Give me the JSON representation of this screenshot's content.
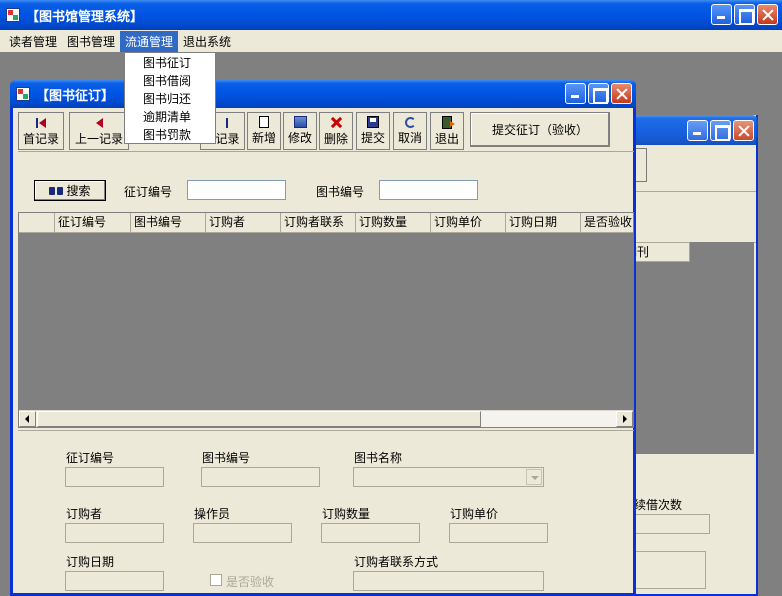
{
  "main_window": {
    "title": "【图书馆管理系统】"
  },
  "menubar": {
    "items": [
      "读者管理",
      "图书管理",
      "流通管理",
      "退出系统"
    ],
    "active_index": 2
  },
  "dropdown": {
    "items": [
      "图书征订",
      "图书借阅",
      "图书归还",
      "逾期清单",
      "图书罚款"
    ]
  },
  "background_window": {
    "column_label": "期刊",
    "field_label": "续借次数"
  },
  "form_window": {
    "title": "【图书征订】",
    "toolbar": {
      "first": "首记录",
      "prev": "上一记录",
      "last": "记录",
      "add": "新增",
      "edit": "修改",
      "delete": "删除",
      "submit": "提交",
      "cancel": "取消",
      "exit": "退出",
      "submit_order": "提交征订（验收）"
    },
    "search": {
      "button": "搜索",
      "order_no_label": "征订编号",
      "order_no_value": "",
      "book_no_label": "图书编号",
      "book_no_value": ""
    },
    "grid": {
      "columns": [
        "",
        "征订编号",
        "图书编号",
        "订购者",
        "订购者联系",
        "订购数量",
        "订购单价",
        "订购日期",
        "是否验收"
      ],
      "rows": []
    },
    "detail": {
      "order_no_label": "征订编号",
      "book_no_label": "图书编号",
      "book_name_label": "图书名称",
      "purchaser_label": "订购者",
      "operator_label": "操作员",
      "quantity_label": "订购数量",
      "unit_price_label": "订购单价",
      "date_label": "订购日期",
      "accepted_label": "是否验收",
      "contact_label": "订购者联系方式"
    }
  },
  "colors": {
    "titlebar": "#0054e3",
    "menu_highlight": "#316ac5",
    "window_face": "#ece9d8",
    "mdi_background": "#808080"
  }
}
